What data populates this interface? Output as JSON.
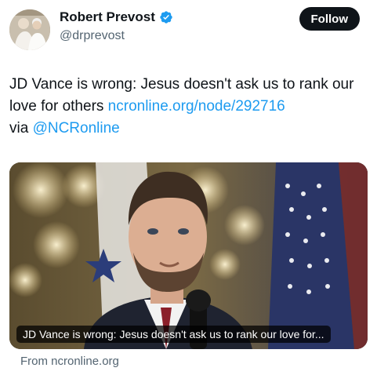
{
  "author": {
    "display_name": "Robert Prevost",
    "handle": "@drprevost",
    "verified": true,
    "verified_color": "#1d9bf0"
  },
  "follow_label": "Follow",
  "tweet": {
    "text": "JD Vance is wrong: Jesus doesn't ask us to rank our love for others ",
    "link": "ncronline.org/node/292716",
    "via_text": "via ",
    "mention": "@NCRonline"
  },
  "card": {
    "title": "JD Vance is wrong: Jesus doesn't ask us to rank our love for...",
    "source": "From ncronline.org"
  },
  "colors": {
    "accent": "#1d9bf0",
    "button_bg": "#0f1419",
    "secondary_text": "#536471"
  }
}
